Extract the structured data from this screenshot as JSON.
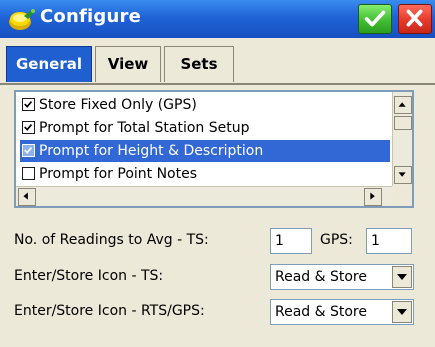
{
  "window": {
    "title": "Configure",
    "ok_icon": "checkmark-icon",
    "close_icon": "close-x-icon"
  },
  "tabs": [
    {
      "label": "General",
      "active": true
    },
    {
      "label": "View",
      "active": false
    },
    {
      "label": "Sets",
      "active": false
    }
  ],
  "options_list": {
    "items": [
      {
        "label": "Store Fixed Only (GPS)",
        "checked": true,
        "selected": false
      },
      {
        "label": "Prompt for Total Station Setup",
        "checked": true,
        "selected": false
      },
      {
        "label": "Prompt for Height & Description",
        "checked": true,
        "selected": true
      },
      {
        "label": "Prompt for Point Notes",
        "checked": false,
        "selected": false
      }
    ]
  },
  "readings": {
    "label": "No. of Readings to Avg  -  TS:",
    "ts_value": "1",
    "gps_label": "GPS:",
    "gps_value": "1"
  },
  "icon_ts": {
    "label": "Enter/Store Icon - TS:",
    "value": "Read & Store"
  },
  "icon_rts": {
    "label": "Enter/Store Icon - RTS/GPS:",
    "value": "Read & Store"
  },
  "colors": {
    "titlebar": "#1f63d6",
    "active_tab": "#1f5fd0",
    "selection": "#3168d5",
    "ok_button": "#3dbb2e",
    "close_button": "#e53a2a"
  }
}
